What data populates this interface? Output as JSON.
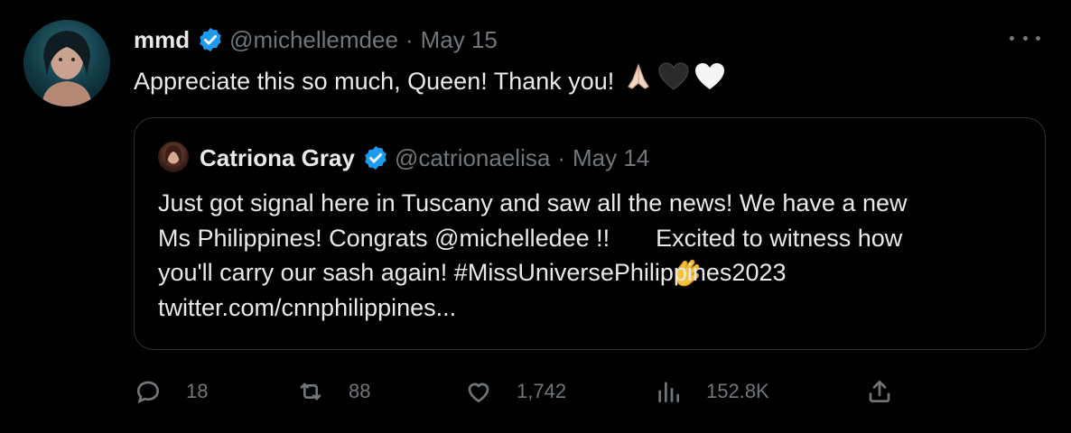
{
  "tweet": {
    "author_name": "mmd",
    "author_handle": "@michellemdee",
    "separator": "·",
    "date": "May 15",
    "text": "Appreciate this so much, Queen! Thank you!",
    "emojis": [
      "folded-hands",
      "black-heart",
      "white-heart"
    ]
  },
  "quote": {
    "author_name": "Catriona Gray",
    "author_handle": "@catrionaelisa",
    "separator": "·",
    "date": "May 14",
    "text_lines": [
      "Just got signal here in Tuscany and saw all the news! We have a new",
      "Ms Philippines! Congrats @michelledee !! ",
      "you'll carry our sash again! #MissUniversePhilippines2023",
      "twitter.com/cnnphilippines..."
    ],
    "line2_after_emoji": " Excited to witness how",
    "emoji": "clapping-hands"
  },
  "actions": {
    "replies": "18",
    "retweets": "88",
    "likes": "1,742",
    "views": "152.8K"
  },
  "colors": {
    "accent": "#1d9bf0",
    "muted": "#71767b",
    "text": "#e7e9ea",
    "border": "#2f3336"
  }
}
